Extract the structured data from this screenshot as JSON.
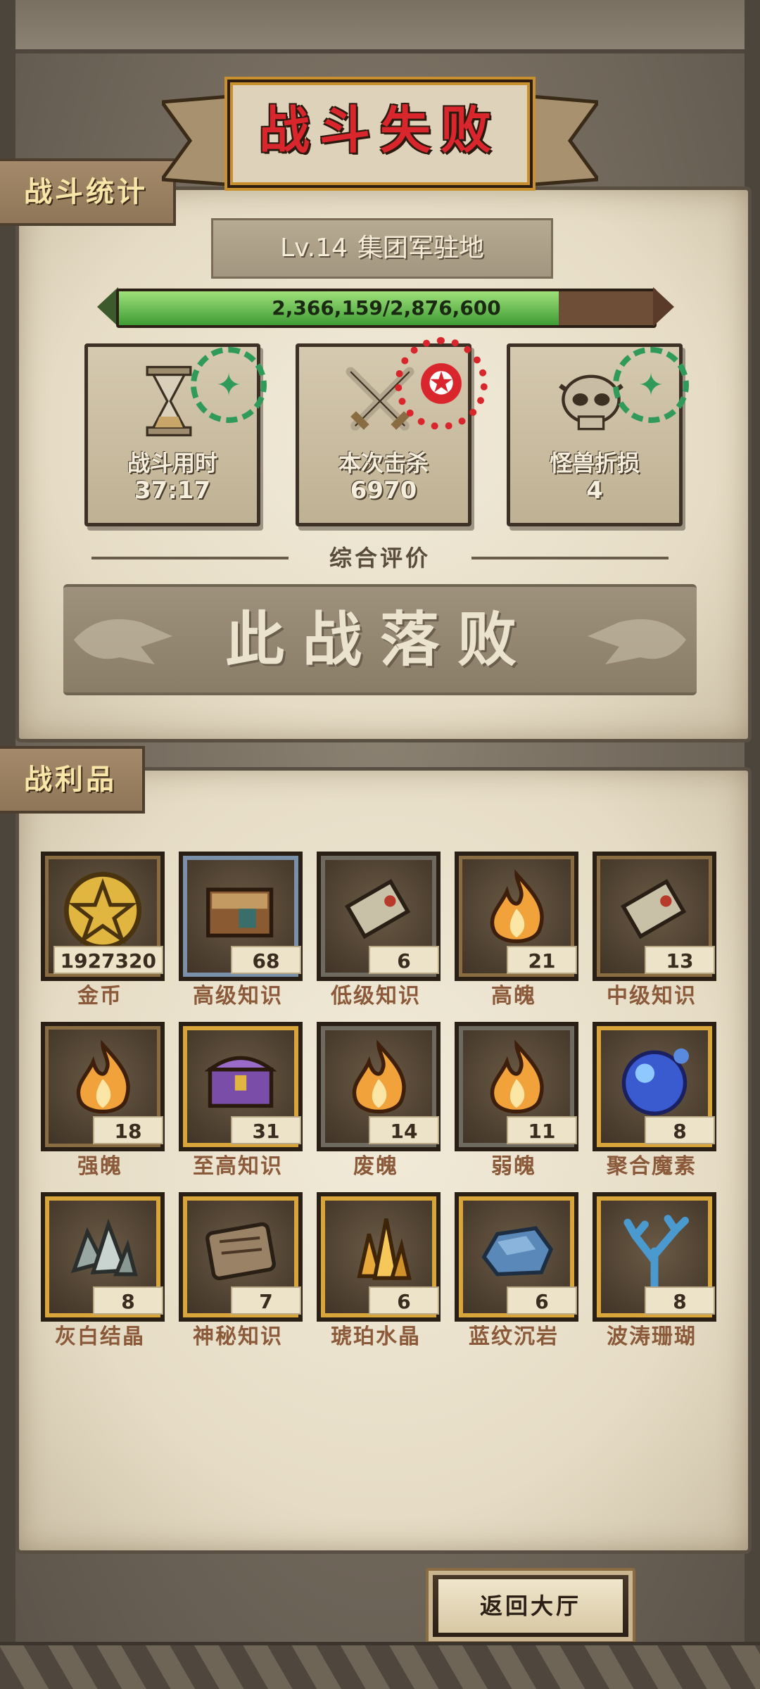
{
  "header": {
    "title": "战斗失败"
  },
  "stats_section": {
    "tag": "战斗统计",
    "level": "Lv.14",
    "location": "集团军驻地",
    "progress": {
      "text": "2,366,159/2,876,600",
      "current": 2366159,
      "max": 2876600
    },
    "cards": [
      {
        "label": "战斗用时",
        "value": "37:17",
        "icon": "hourglass-icon",
        "stamp": "stamp-green"
      },
      {
        "label": "本次击杀",
        "value": "6970",
        "icon": "crossed-swords-icon",
        "stamp": "stamp-red"
      },
      {
        "label": "怪兽折损",
        "value": "4",
        "icon": "skull-icon",
        "stamp": "stamp-green"
      }
    ],
    "evaluation_label": "综合评价",
    "verdict": "此战落败"
  },
  "loot_section": {
    "tag": "战利品",
    "items": [
      {
        "name": "金币",
        "count": "1927320",
        "icon": "gold-coin-icon",
        "frame": "brown"
      },
      {
        "name": "高级知识",
        "count": "68",
        "icon": "book-icon",
        "frame": "blue"
      },
      {
        "name": "低级知识",
        "count": "6",
        "icon": "scroll-icon",
        "frame": "gray"
      },
      {
        "name": "高魄",
        "count": "21",
        "icon": "flame-icon",
        "frame": "brown"
      },
      {
        "name": "中级知识",
        "count": "13",
        "icon": "scroll-icon",
        "frame": "brown"
      },
      {
        "name": "强魄",
        "count": "18",
        "icon": "flame-icon",
        "frame": "brown"
      },
      {
        "name": "至高知识",
        "count": "31",
        "icon": "chest-icon",
        "frame": "gold"
      },
      {
        "name": "废魄",
        "count": "14",
        "icon": "flame-icon",
        "frame": "gray"
      },
      {
        "name": "弱魄",
        "count": "11",
        "icon": "flame-icon",
        "frame": "gray"
      },
      {
        "name": "聚合魔素",
        "count": "8",
        "icon": "orb-icon",
        "frame": "gold"
      },
      {
        "name": "灰白结晶",
        "count": "8",
        "icon": "crystal-icon",
        "frame": "gold"
      },
      {
        "name": "神秘知识",
        "count": "7",
        "icon": "tablet-icon",
        "frame": "gold"
      },
      {
        "name": "琥珀水晶",
        "count": "6",
        "icon": "amber-crystal-icon",
        "frame": "gold"
      },
      {
        "name": "蓝纹沉岩",
        "count": "6",
        "icon": "blue-rock-icon",
        "frame": "gold"
      },
      {
        "name": "波涛珊瑚",
        "count": "8",
        "icon": "coral-icon",
        "frame": "gold"
      }
    ]
  },
  "footer": {
    "return_label": "返回大厅"
  }
}
